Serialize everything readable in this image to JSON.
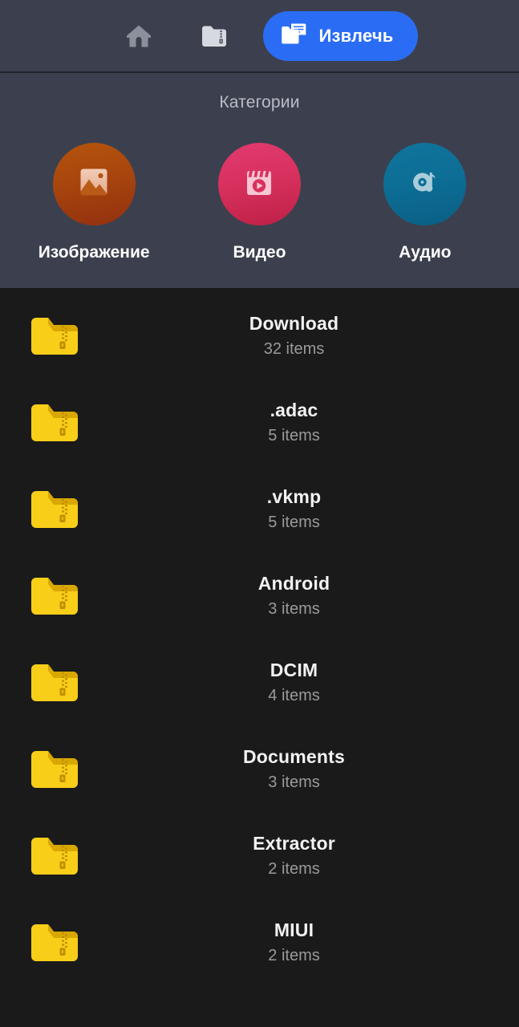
{
  "toolbar": {
    "home_icon": "home-icon",
    "archive_icon": "zip-folder-icon",
    "extract_button_label": "Извлечь",
    "extract_icon": "extract-folder-icon",
    "accent_color": "#2a6df4",
    "background_color": "#3c404e"
  },
  "categories": {
    "title": "Категории",
    "background_color": "#3c404e",
    "items": [
      {
        "label": "Изображение",
        "icon": "image-icon",
        "color": "#a8450e",
        "kind": "image"
      },
      {
        "label": "Видео",
        "icon": "video-clapperboard-play-icon",
        "color": "#d8315f",
        "kind": "video"
      },
      {
        "label": "Аудио",
        "icon": "audio-disc-note-icon",
        "color": "#0d6e96",
        "kind": "audio"
      }
    ]
  },
  "file_list": {
    "background_color": "#1a1a1a",
    "folder_icon": "zip-folder-icon",
    "rows": [
      {
        "name": "Download",
        "subtitle": "32 items"
      },
      {
        "name": ".adac",
        "subtitle": "5 items"
      },
      {
        "name": ".vkmp",
        "subtitle": "5 items"
      },
      {
        "name": "Android",
        "subtitle": "3 items"
      },
      {
        "name": "DCIM",
        "subtitle": "4 items"
      },
      {
        "name": "Documents",
        "subtitle": "3 items"
      },
      {
        "name": "Extractor",
        "subtitle": "2 items"
      },
      {
        "name": "MIUI",
        "subtitle": "2 items"
      }
    ]
  }
}
